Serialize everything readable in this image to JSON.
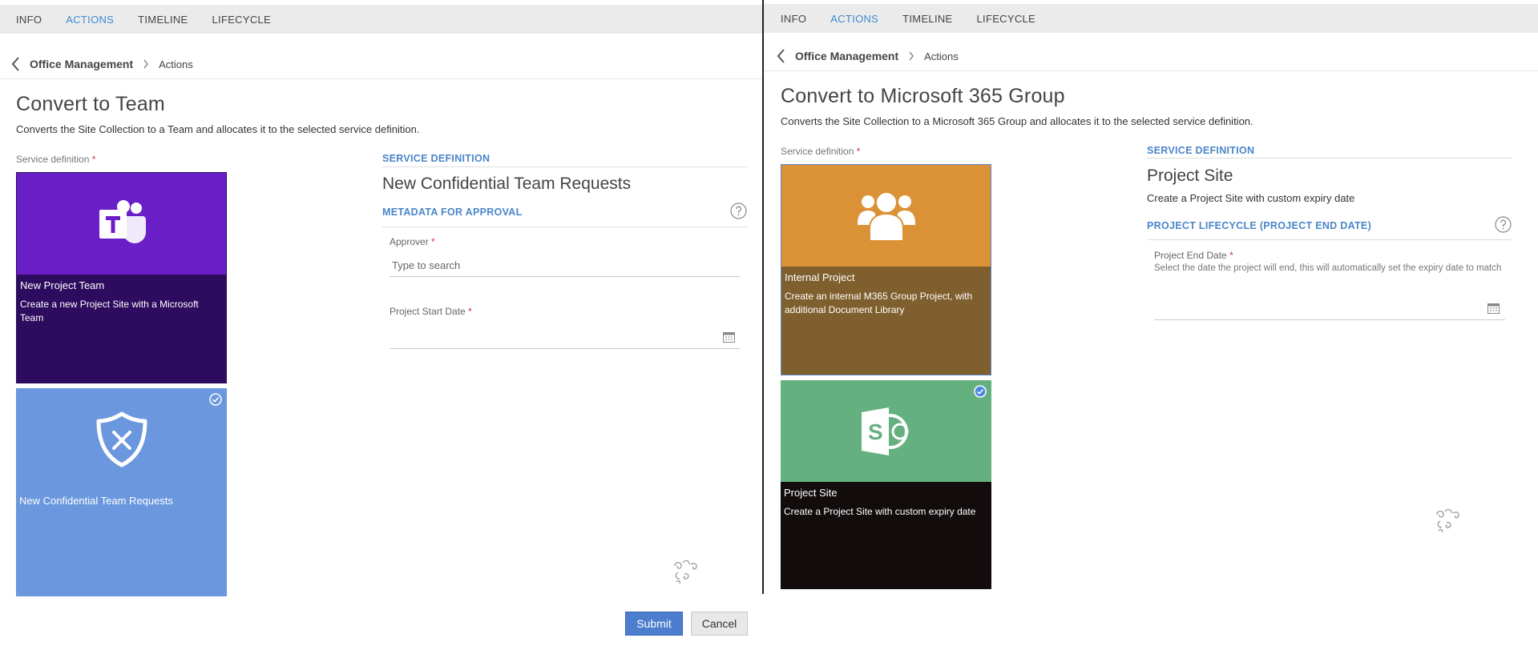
{
  "left": {
    "tabs": [
      {
        "label": "INFO"
      },
      {
        "label": "ACTIONS"
      },
      {
        "label": "TIMELINE"
      },
      {
        "label": "LIFECYCLE"
      }
    ],
    "breadcrumb": {
      "parent": "Office Management",
      "current": "Actions"
    },
    "title": "Convert to Team",
    "description": "Converts the Site Collection to a Team and allocates it to the selected service definition.",
    "service_definition_label": "Service definition",
    "required_mark": "*",
    "tiles": [
      {
        "name": "New Project Team",
        "description": "Create a new Project Site with a Microsoft Team",
        "icon": "teams-icon",
        "top_color": "#6a1ec8",
        "bottom_color": "#2d0b5e",
        "selected": false
      },
      {
        "name": "New Confidential Team Requests",
        "description": "",
        "icon": "shield-x-icon",
        "top_color": "#6a97dd",
        "bottom_color": "#6a97dd",
        "selected": true
      }
    ],
    "details": {
      "service_definition_heading": "SERVICE DEFINITION",
      "service_definition_value": "New Confidential Team Requests",
      "metadata_heading": "METADATA FOR APPROVAL",
      "approver_label": "Approver",
      "approver_placeholder": "Type to search",
      "start_date_label": "Project Start Date",
      "start_date_value": ""
    },
    "buttons": {
      "submit": "Submit",
      "cancel": "Cancel"
    }
  },
  "right": {
    "tabs": [
      {
        "label": "INFO"
      },
      {
        "label": "ACTIONS"
      },
      {
        "label": "TIMELINE"
      },
      {
        "label": "LIFECYCLE"
      }
    ],
    "breadcrumb": {
      "parent": "Office Management",
      "current": "Actions"
    },
    "title": "Convert to Microsoft 365 Group",
    "description": "Converts the Site Collection to a Microsoft 365 Group and allocates it to the selected service definition.",
    "service_definition_label": "Service definition",
    "required_mark": "*",
    "tiles": [
      {
        "name": "Internal Project",
        "description": "Create an internal M365 Group Project, with additional Document Library",
        "icon": "people-group-icon",
        "top_color": "#db9236",
        "bottom_color": "#805f2e",
        "selected": false
      },
      {
        "name": "Project Site",
        "description": "Create a Project Site with custom expiry date",
        "icon": "sharepoint-icon",
        "top_color": "#64b07f",
        "bottom_color": "#120c0c",
        "selected": true
      }
    ],
    "details": {
      "service_definition_heading": "SERVICE DEFINITION",
      "service_definition_value": "Project Site",
      "service_definition_desc": "Create a Project Site with custom expiry date",
      "lifecycle_heading": "PROJECT LIFECYCLE (PROJECT END DATE)",
      "end_date_label": "Project End Date",
      "end_date_help": "Select the date the project will end, this will automatically set the expiry date to match",
      "end_date_value": ""
    }
  }
}
